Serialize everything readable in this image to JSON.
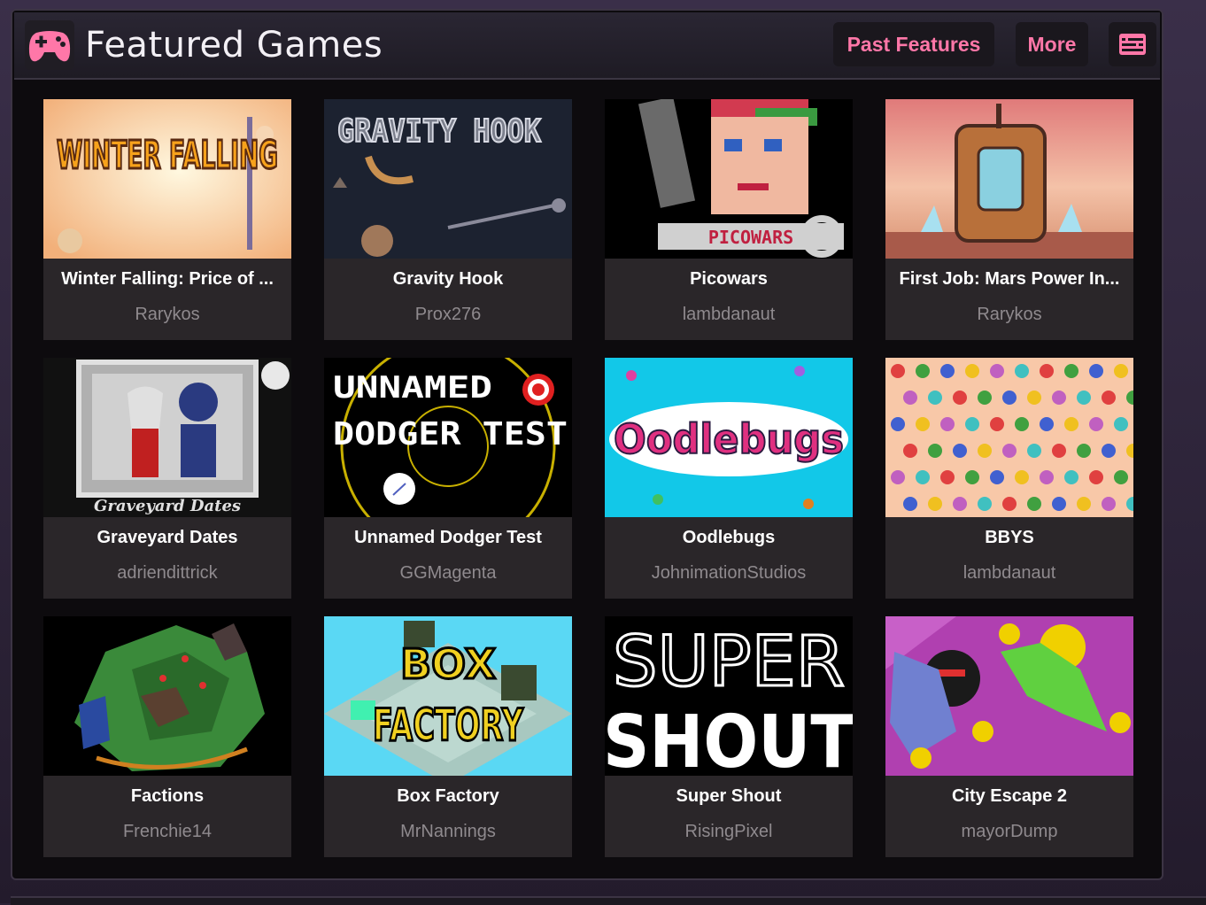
{
  "header": {
    "title": "Featured Games",
    "logo_icon": "gamepad-icon",
    "past_features_label": "Past Features",
    "more_label": "More",
    "menu_icon": "list-icon"
  },
  "colors": {
    "accent": "#ff77a8",
    "panel_bg": "#0d0b0e",
    "card_bg": "#2a2629"
  },
  "games": [
    {
      "title": "Winter Falling: Price of ...",
      "author": "Rarykos",
      "thumb_text": "WINTER FALLING"
    },
    {
      "title": "Gravity Hook",
      "author": "Prox276",
      "thumb_text": "GRAVITY HOOK"
    },
    {
      "title": "Picowars",
      "author": "lambdanaut",
      "thumb_text": "PICOWARS"
    },
    {
      "title": "First Job: Mars Power In...",
      "author": "Rarykos",
      "thumb_text": ""
    },
    {
      "title": "Graveyard Dates",
      "author": "adriendittrick",
      "thumb_text": "Graveyard Dates"
    },
    {
      "title": "Unnamed Dodger Test",
      "author": "GGMagenta",
      "thumb_text": "UNNAMED DODGER TEST"
    },
    {
      "title": "Oodlebugs",
      "author": "JohnimationStudios",
      "thumb_text": "Oodlebugs"
    },
    {
      "title": "BBYS",
      "author": "lambdanaut",
      "thumb_text": ""
    },
    {
      "title": "Factions",
      "author": "Frenchie14",
      "thumb_text": ""
    },
    {
      "title": "Box Factory",
      "author": "MrNannings",
      "thumb_text": "BOX FACTORY"
    },
    {
      "title": "Super Shout",
      "author": "RisingPixel",
      "thumb_text": "SUPER SHOUT"
    },
    {
      "title": "City Escape 2",
      "author": "mayorDump",
      "thumb_text": ""
    }
  ]
}
